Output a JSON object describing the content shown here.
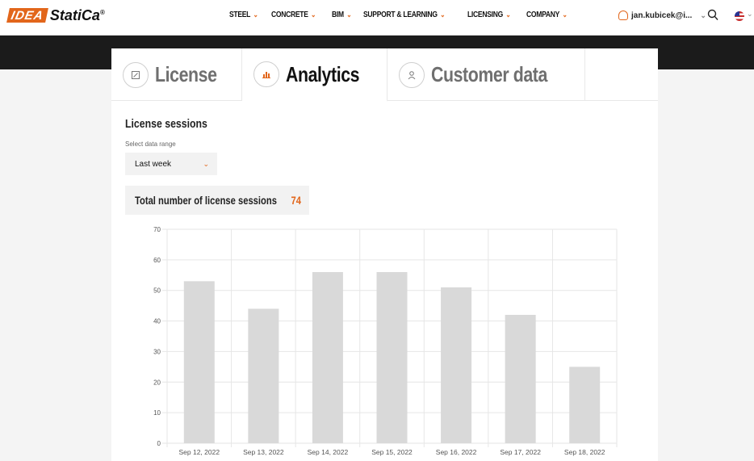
{
  "header": {
    "logo_mark": "IDEA",
    "logo_text": "StatiCa",
    "logo_reg": "®",
    "nav": [
      {
        "label": "STEEL"
      },
      {
        "label": "CONCRETE"
      },
      {
        "label": "BIM"
      },
      {
        "label": "SUPPORT & LEARNING"
      },
      {
        "label": "LICENSING"
      },
      {
        "label": "COMPANY"
      }
    ],
    "user": "jan.kubicek@i...",
    "icons": {
      "user": "user-icon",
      "search": "search-icon",
      "flag": "us-flag-icon",
      "chevron": "chevron-down-icon"
    },
    "accent": "#e2661b"
  },
  "tabs": [
    {
      "label": "License",
      "icon": "license-icon",
      "active": false
    },
    {
      "label": "Analytics",
      "icon": "analytics-icon",
      "active": true
    },
    {
      "label": "Customer data",
      "icon": "customer-icon",
      "active": false
    }
  ],
  "main": {
    "section_title": "License sessions",
    "range_label": "Select data range",
    "range_value": "Last week",
    "total_label": "Total number of license sessions",
    "total_value": "74"
  },
  "chart_data": {
    "type": "bar",
    "categories": [
      "Sep 12, 2022",
      "Sep 13, 2022",
      "Sep 14, 2022",
      "Sep 15, 2022",
      "Sep 16, 2022",
      "Sep 17, 2022",
      "Sep 18, 2022"
    ],
    "values": [
      53,
      44,
      56,
      56,
      51,
      42,
      25
    ],
    "yticks": [
      "0",
      "10",
      "20",
      "30",
      "40",
      "50",
      "60",
      "70"
    ],
    "ylim": [
      0,
      70
    ],
    "grid": true,
    "bar_color": "#d9d9d9"
  }
}
